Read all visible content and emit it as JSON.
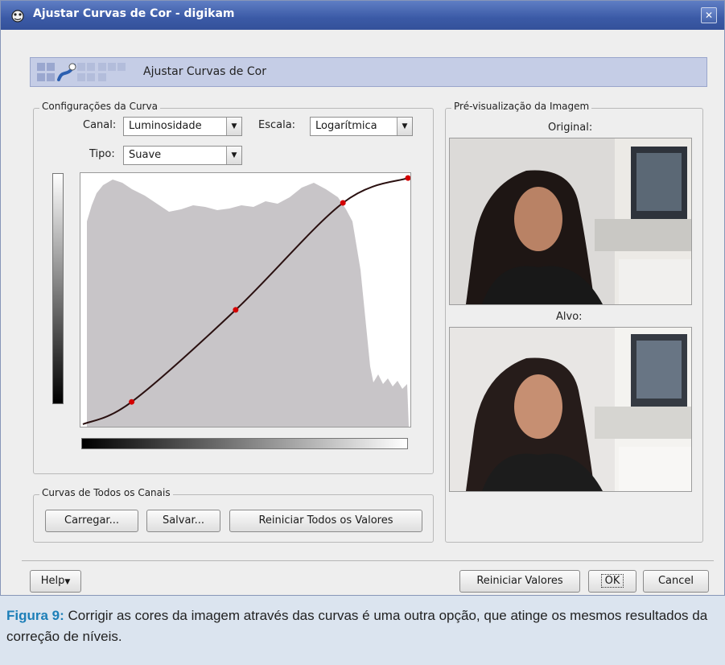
{
  "window": {
    "title": "Ajustar Curvas de Cor - digikam",
    "header_title": "Ajustar Curvas de Cor"
  },
  "curve_settings": {
    "group_label": "Configurações da Curva",
    "channel_label": "Canal:",
    "channel_value": "Luminosidade",
    "scale_label": "Escala:",
    "scale_value": "Logarítmica",
    "type_label": "Tipo:",
    "type_value": "Suave"
  },
  "curve_points": [
    {
      "input": 0.15,
      "output": 0.09
    },
    {
      "input": 0.47,
      "output": 0.46
    },
    {
      "input": 0.8,
      "output": 0.89
    },
    {
      "input": 1.0,
      "output": 0.99
    }
  ],
  "all_channels": {
    "group_label": "Curvas de Todos os Canais",
    "load_button": "Carregar...",
    "save_button": "Salvar...",
    "reset_all_button": "Reiniciar Todos os Valores"
  },
  "preview": {
    "group_label": "Pré-visualização da Imagem",
    "original_label": "Original:",
    "target_label": "Alvo:"
  },
  "footer": {
    "help_button": "Help",
    "reset_button": "Reiniciar Valores",
    "ok_button": "OK",
    "cancel_button": "Cancel"
  },
  "caption": {
    "figure_label": "Figura 9:",
    "text": " Corrigir as cores da imagem através das curvas é uma outra opção, que atinge os mesmos resultados da correção de níveis."
  },
  "colors": {
    "titlebar": "#3b5aa6",
    "histogram": "#c8c5c8",
    "curve_point": "#d40000",
    "caption_accent": "#1d7fb8"
  }
}
